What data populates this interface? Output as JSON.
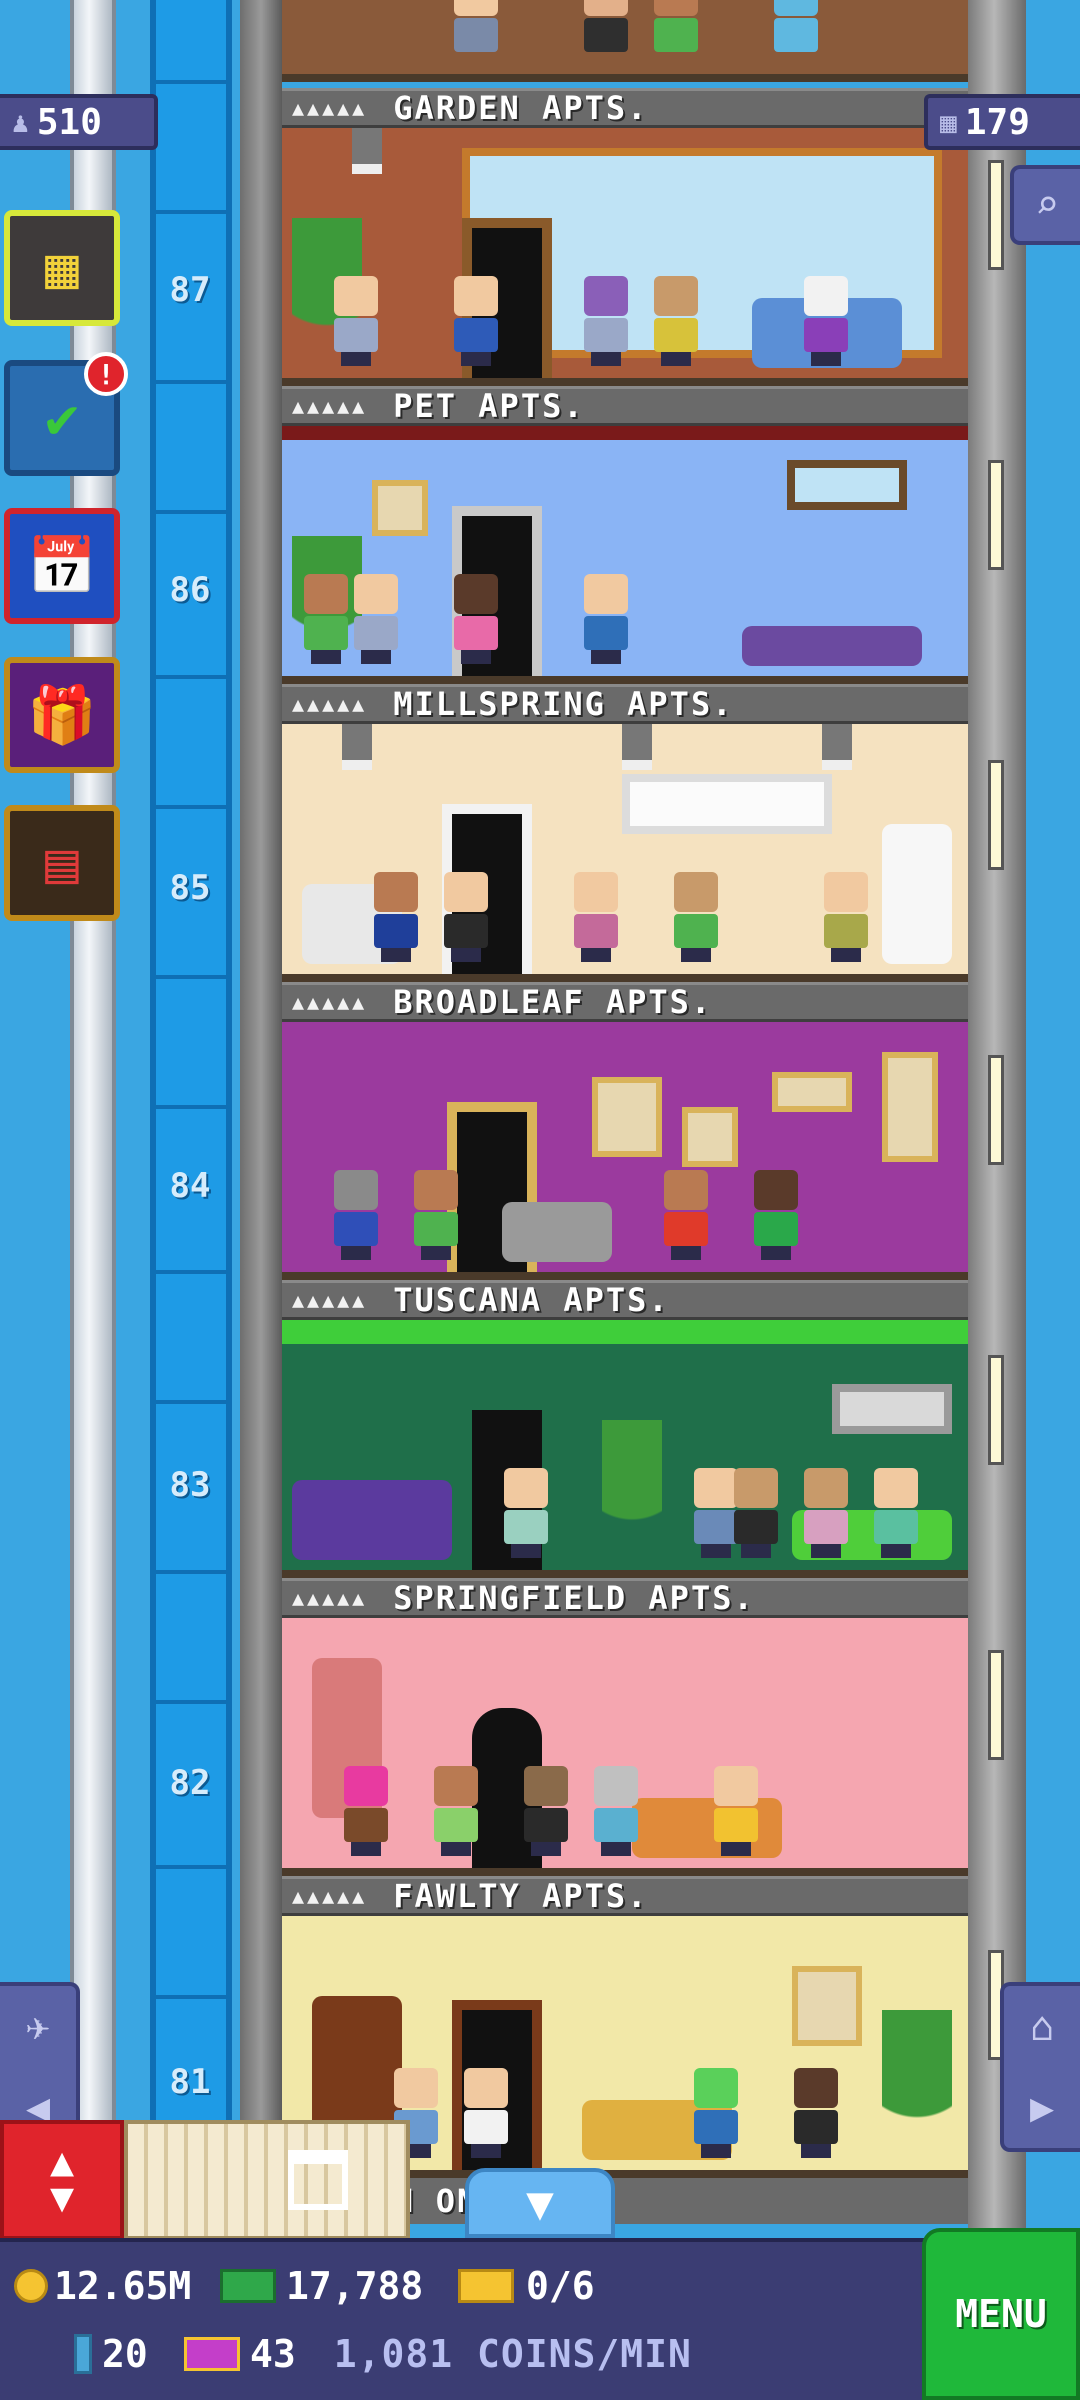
{
  "population": "510",
  "floor_count": "179",
  "floors": [
    {
      "number": "87",
      "name": "GARDEN APTS.",
      "stars": "▲▲▲▲▲"
    },
    {
      "number": "86",
      "name": "PET APTS.",
      "stars": "▲▲▲▲▲"
    },
    {
      "number": "85",
      "name": "MILLSPRING APTS.",
      "stars": "▲▲▲▲▲"
    },
    {
      "number": "84",
      "name": "BROADLEAF APTS.",
      "stars": "▲▲▲▲▲"
    },
    {
      "number": "83",
      "name": "TUSCANA APTS.",
      "stars": "▲▲▲▲▲"
    },
    {
      "number": "82",
      "name": "SPRINGFIELD APTS.",
      "stars": "▲▲▲▲▲"
    },
    {
      "number": "81",
      "name": "FAWLTY APTS.",
      "stars": "▲▲▲▲▲"
    }
  ],
  "partial_floor_label": "M        ON APTS.",
  "notification_count": "!",
  "currency": {
    "coins": "12.65M",
    "cash": "17,788",
    "tickets": "0/6",
    "bux": "20",
    "vip": "43",
    "rate": "1,081 COINS/MIN"
  },
  "menu_label": "MENU",
  "icons": {
    "population": "person-icon",
    "floors": "building-icon",
    "zoom": "magnifier-icon",
    "build": "building-grid-icon",
    "missions": "checklist-icon",
    "calendar": "calendar-icon",
    "gift": "gift-icon",
    "shop": "store-icon"
  }
}
